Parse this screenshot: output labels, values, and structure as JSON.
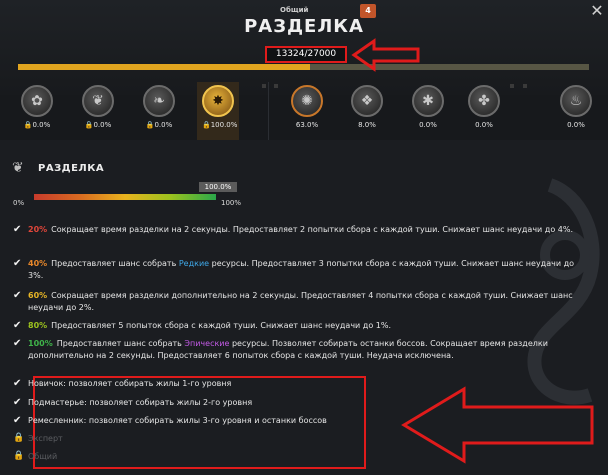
{
  "header": {
    "tab_label": "Общий",
    "tab_badge": "4",
    "title": "РАЗДЕЛКА",
    "xp": "13324/27000",
    "close_icon": "close-icon"
  },
  "skills": [
    {
      "icon": "lock-icon",
      "pct": "0.0%"
    },
    {
      "icon": "lock-icon",
      "pct": "0.0%"
    },
    {
      "icon": "lock-icon",
      "pct": "0.0%"
    },
    {
      "icon": "lock-icon",
      "pct": "100.0%"
    },
    {
      "pct": "63.0%"
    },
    {
      "pct": "8.0%"
    },
    {
      "pct": "0.0%"
    },
    {
      "pct": "0.0%"
    },
    {
      "pct": "0.0%"
    }
  ],
  "details": {
    "title": "РАЗДЕЛКА",
    "range_min": "0%",
    "range_max": "100%",
    "current_pct": "100.0%",
    "tiers": [
      {
        "pct": "20%",
        "color": "#e0463a",
        "text": "Сокращает время разделки на 2 секунды.  Предоставляет 2 попытки сбора с каждой туши.  Снижает шанс неудачи до 4%."
      },
      {
        "pct": "40%",
        "color": "#e8872a",
        "pre": "Предоставляет шанс собрать ",
        "hl": "Редкие",
        "hl_color": "#3fa8e8",
        "post": " ресурсы.  Предоставляет 3 попытки сбора с каждой туши.  Снижает шанс неудачи до 3%."
      },
      {
        "pct": "60%",
        "color": "#e7b526",
        "text": "Сокращает время разделки дополнительно на 2 секунды.  Предоставляет 4 попытки сбора с каждой туши.  Снижает шанс неудачи до 2%."
      },
      {
        "pct": "80%",
        "color": "#9cc21e",
        "text": "Предоставляет 5 попыток сбора с каждой туши.  Снижает шанс неудачи до 1%."
      },
      {
        "pct": "100%",
        "color": "#3fb34a",
        "pre": "Предоставляет шанс собрать ",
        "hl": "Эпические",
        "hl_color": "#c35ae6",
        "post": " ресурсы.  Позволяет собирать останки боссов.  Сокращает время разделки дополнительно на 2 секунды.  Предоставляет 6 попыток сбора с каждой туши.  Неудача исключена."
      }
    ]
  },
  "unlocks": [
    {
      "text": "Новичок: позволяет собирать жилы 1-го уровня",
      "locked": false
    },
    {
      "text": "Подмастерье: позволяет собирать жилы 2-го уровня",
      "locked": false
    },
    {
      "text": "Ремесленник: позволяет собирать жилы 3-го уровня и останки боссов",
      "locked": false
    },
    {
      "text": "Эксперт",
      "locked": true
    },
    {
      "text": "Общий",
      "locked": true
    }
  ],
  "colors": {
    "accent": "#e1a51f",
    "annotation": "#e01b1b"
  }
}
